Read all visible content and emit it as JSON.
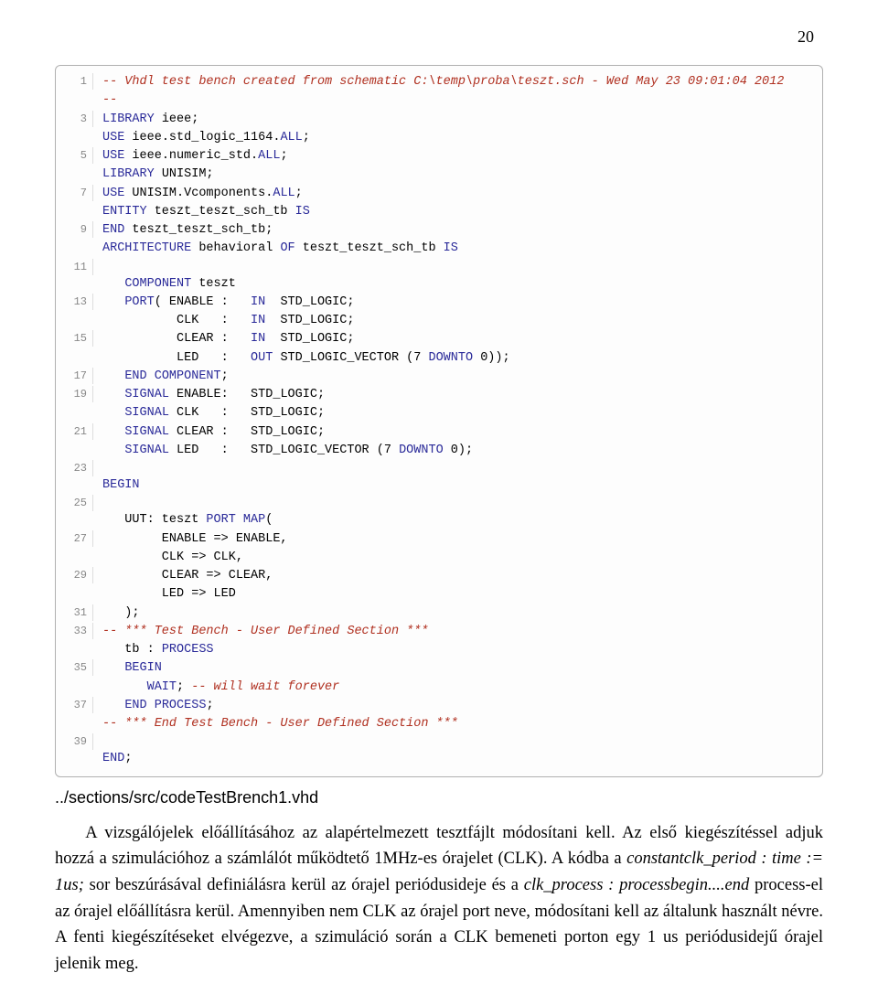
{
  "page_number": "20",
  "code": [
    {
      "n": "1",
      "spans": [
        {
          "c": "comment",
          "t": "-- Vhdl test bench created from schematic C:\\temp\\proba\\teszt.sch - Wed May 23 09:01:04 2012"
        }
      ]
    },
    {
      "n": "",
      "spans": [
        {
          "c": "comment",
          "t": "--"
        }
      ]
    },
    {
      "n": "3",
      "spans": [
        {
          "c": "keyword",
          "t": "LIBRARY"
        },
        {
          "c": "ident",
          "t": " ieee;"
        }
      ]
    },
    {
      "n": "",
      "spans": [
        {
          "c": "keyword",
          "t": "USE"
        },
        {
          "c": "ident",
          "t": " ieee.std_logic_1164."
        },
        {
          "c": "keyword",
          "t": "ALL"
        },
        {
          "c": "ident",
          "t": ";"
        }
      ]
    },
    {
      "n": "5",
      "spans": [
        {
          "c": "keyword",
          "t": "USE"
        },
        {
          "c": "ident",
          "t": " ieee.numeric_std."
        },
        {
          "c": "keyword",
          "t": "ALL"
        },
        {
          "c": "ident",
          "t": ";"
        }
      ]
    },
    {
      "n": "",
      "spans": [
        {
          "c": "keyword",
          "t": "LIBRARY"
        },
        {
          "c": "ident",
          "t": " UNISIM;"
        }
      ]
    },
    {
      "n": "7",
      "spans": [
        {
          "c": "keyword",
          "t": "USE"
        },
        {
          "c": "ident",
          "t": " UNISIM.Vcomponents."
        },
        {
          "c": "keyword",
          "t": "ALL"
        },
        {
          "c": "ident",
          "t": ";"
        }
      ]
    },
    {
      "n": "",
      "spans": [
        {
          "c": "keyword",
          "t": "ENTITY"
        },
        {
          "c": "ident",
          "t": " teszt_teszt_sch_tb "
        },
        {
          "c": "keyword",
          "t": "IS"
        }
      ]
    },
    {
      "n": "9",
      "spans": [
        {
          "c": "keyword",
          "t": "END"
        },
        {
          "c": "ident",
          "t": " teszt_teszt_sch_tb;"
        }
      ]
    },
    {
      "n": "",
      "spans": [
        {
          "c": "keyword",
          "t": "ARCHITECTURE"
        },
        {
          "c": "ident",
          "t": " behavioral "
        },
        {
          "c": "keyword",
          "t": "OF"
        },
        {
          "c": "ident",
          "t": " teszt_teszt_sch_tb "
        },
        {
          "c": "keyword",
          "t": "IS"
        }
      ]
    },
    {
      "n": "11",
      "spans": [
        {
          "c": "ident",
          "t": ""
        }
      ]
    },
    {
      "n": "",
      "spans": [
        {
          "c": "ident",
          "t": "   "
        },
        {
          "c": "keyword",
          "t": "COMPONENT"
        },
        {
          "c": "ident",
          "t": " teszt"
        }
      ]
    },
    {
      "n": "13",
      "spans": [
        {
          "c": "ident",
          "t": "   "
        },
        {
          "c": "keyword",
          "t": "PORT"
        },
        {
          "c": "ident",
          "t": "( ENABLE :   "
        },
        {
          "c": "keyword",
          "t": "IN"
        },
        {
          "c": "ident",
          "t": "  STD_LOGIC;"
        }
      ]
    },
    {
      "n": "",
      "spans": [
        {
          "c": "ident",
          "t": "          CLK   :   "
        },
        {
          "c": "keyword",
          "t": "IN"
        },
        {
          "c": "ident",
          "t": "  STD_LOGIC;"
        }
      ]
    },
    {
      "n": "15",
      "spans": [
        {
          "c": "ident",
          "t": "          CLEAR :   "
        },
        {
          "c": "keyword",
          "t": "IN"
        },
        {
          "c": "ident",
          "t": "  STD_LOGIC;"
        }
      ]
    },
    {
      "n": "",
      "spans": [
        {
          "c": "ident",
          "t": "          LED   :   "
        },
        {
          "c": "keyword",
          "t": "OUT"
        },
        {
          "c": "ident",
          "t": " STD_LOGIC_VECTOR (7 "
        },
        {
          "c": "keyword",
          "t": "DOWNTO"
        },
        {
          "c": "ident",
          "t": " 0));"
        }
      ]
    },
    {
      "n": "17",
      "spans": [
        {
          "c": "ident",
          "t": "   "
        },
        {
          "c": "keyword",
          "t": "END COMPONENT"
        },
        {
          "c": "ident",
          "t": ";"
        }
      ]
    },
    {
      "n": "",
      "spans": [
        {
          "c": "ident",
          "t": ""
        }
      ]
    },
    {
      "n": "19",
      "spans": [
        {
          "c": "ident",
          "t": "   "
        },
        {
          "c": "keyword",
          "t": "SIGNAL"
        },
        {
          "c": "ident",
          "t": " ENABLE:   STD_LOGIC;"
        }
      ]
    },
    {
      "n": "",
      "spans": [
        {
          "c": "ident",
          "t": "   "
        },
        {
          "c": "keyword",
          "t": "SIGNAL"
        },
        {
          "c": "ident",
          "t": " CLK   :   STD_LOGIC;"
        }
      ]
    },
    {
      "n": "21",
      "spans": [
        {
          "c": "ident",
          "t": "   "
        },
        {
          "c": "keyword",
          "t": "SIGNAL"
        },
        {
          "c": "ident",
          "t": " CLEAR :   STD_LOGIC;"
        }
      ]
    },
    {
      "n": "",
      "spans": [
        {
          "c": "ident",
          "t": "   "
        },
        {
          "c": "keyword",
          "t": "SIGNAL"
        },
        {
          "c": "ident",
          "t": " LED   :   STD_LOGIC_VECTOR (7 "
        },
        {
          "c": "keyword",
          "t": "DOWNTO"
        },
        {
          "c": "ident",
          "t": " 0);"
        }
      ]
    },
    {
      "n": "23",
      "spans": [
        {
          "c": "ident",
          "t": ""
        }
      ]
    },
    {
      "n": "",
      "spans": [
        {
          "c": "keyword",
          "t": "BEGIN"
        }
      ]
    },
    {
      "n": "25",
      "spans": [
        {
          "c": "ident",
          "t": ""
        }
      ]
    },
    {
      "n": "",
      "spans": [
        {
          "c": "ident",
          "t": "   UUT: teszt "
        },
        {
          "c": "keyword",
          "t": "PORT MAP"
        },
        {
          "c": "ident",
          "t": "("
        }
      ]
    },
    {
      "n": "27",
      "spans": [
        {
          "c": "ident",
          "t": "        ENABLE => ENABLE,"
        }
      ]
    },
    {
      "n": "",
      "spans": [
        {
          "c": "ident",
          "t": "        CLK => CLK,"
        }
      ]
    },
    {
      "n": "29",
      "spans": [
        {
          "c": "ident",
          "t": "        CLEAR => CLEAR,"
        }
      ]
    },
    {
      "n": "",
      "spans": [
        {
          "c": "ident",
          "t": "        LED => LED"
        }
      ]
    },
    {
      "n": "31",
      "spans": [
        {
          "c": "ident",
          "t": "   );"
        }
      ]
    },
    {
      "n": "",
      "spans": [
        {
          "c": "ident",
          "t": ""
        }
      ]
    },
    {
      "n": "33",
      "spans": [
        {
          "c": "comment",
          "t": "-- *** Test Bench - User Defined Section ***"
        }
      ]
    },
    {
      "n": "",
      "spans": [
        {
          "c": "ident",
          "t": "   tb : "
        },
        {
          "c": "keyword",
          "t": "PROCESS"
        }
      ]
    },
    {
      "n": "35",
      "spans": [
        {
          "c": "ident",
          "t": "   "
        },
        {
          "c": "keyword",
          "t": "BEGIN"
        }
      ]
    },
    {
      "n": "",
      "spans": [
        {
          "c": "ident",
          "t": "      "
        },
        {
          "c": "keyword",
          "t": "WAIT"
        },
        {
          "c": "ident",
          "t": "; "
        },
        {
          "c": "comment",
          "t": "-- will wait forever"
        }
      ]
    },
    {
      "n": "37",
      "spans": [
        {
          "c": "ident",
          "t": "   "
        },
        {
          "c": "keyword",
          "t": "END PROCESS"
        },
        {
          "c": "ident",
          "t": ";"
        }
      ]
    },
    {
      "n": "",
      "spans": [
        {
          "c": "comment",
          "t": "-- *** End Test Bench - User Defined Section ***"
        }
      ]
    },
    {
      "n": "39",
      "spans": [
        {
          "c": "ident",
          "t": ""
        }
      ]
    },
    {
      "n": "",
      "spans": [
        {
          "c": "keyword",
          "t": "END"
        },
        {
          "c": "ident",
          "t": ";"
        }
      ]
    }
  ],
  "filepath": "../sections/src/codeTestBrench1.vhd",
  "paragraph_parts": [
    {
      "t": "A vizsgálójelek előállításához az alapértelmezett tesztfájlt módosítani kell. Az első kiegészítéssel adjuk hozzá a szimulációhoz a számlálót működtető 1MHz-es órajelet (CLK). A kódba a ",
      "i": false
    },
    {
      "t": "constantclk_period : time := 1us;",
      "i": true
    },
    {
      "t": " sor beszúrásával definiálásra kerül az órajel periódusideje és a ",
      "i": false
    },
    {
      "t": "clk_process : processbegin....end",
      "i": true
    },
    {
      "t": " process-el az órajel előállításra kerül. Amennyiben nem CLK az órajel port neve, módosítani kell az általunk használt névre. A fenti kiegészítéseket elvégezve, a szimuláció során a CLK bemeneti porton egy 1 us periódusidejű órajel jelenik meg.",
      "i": false
    }
  ]
}
